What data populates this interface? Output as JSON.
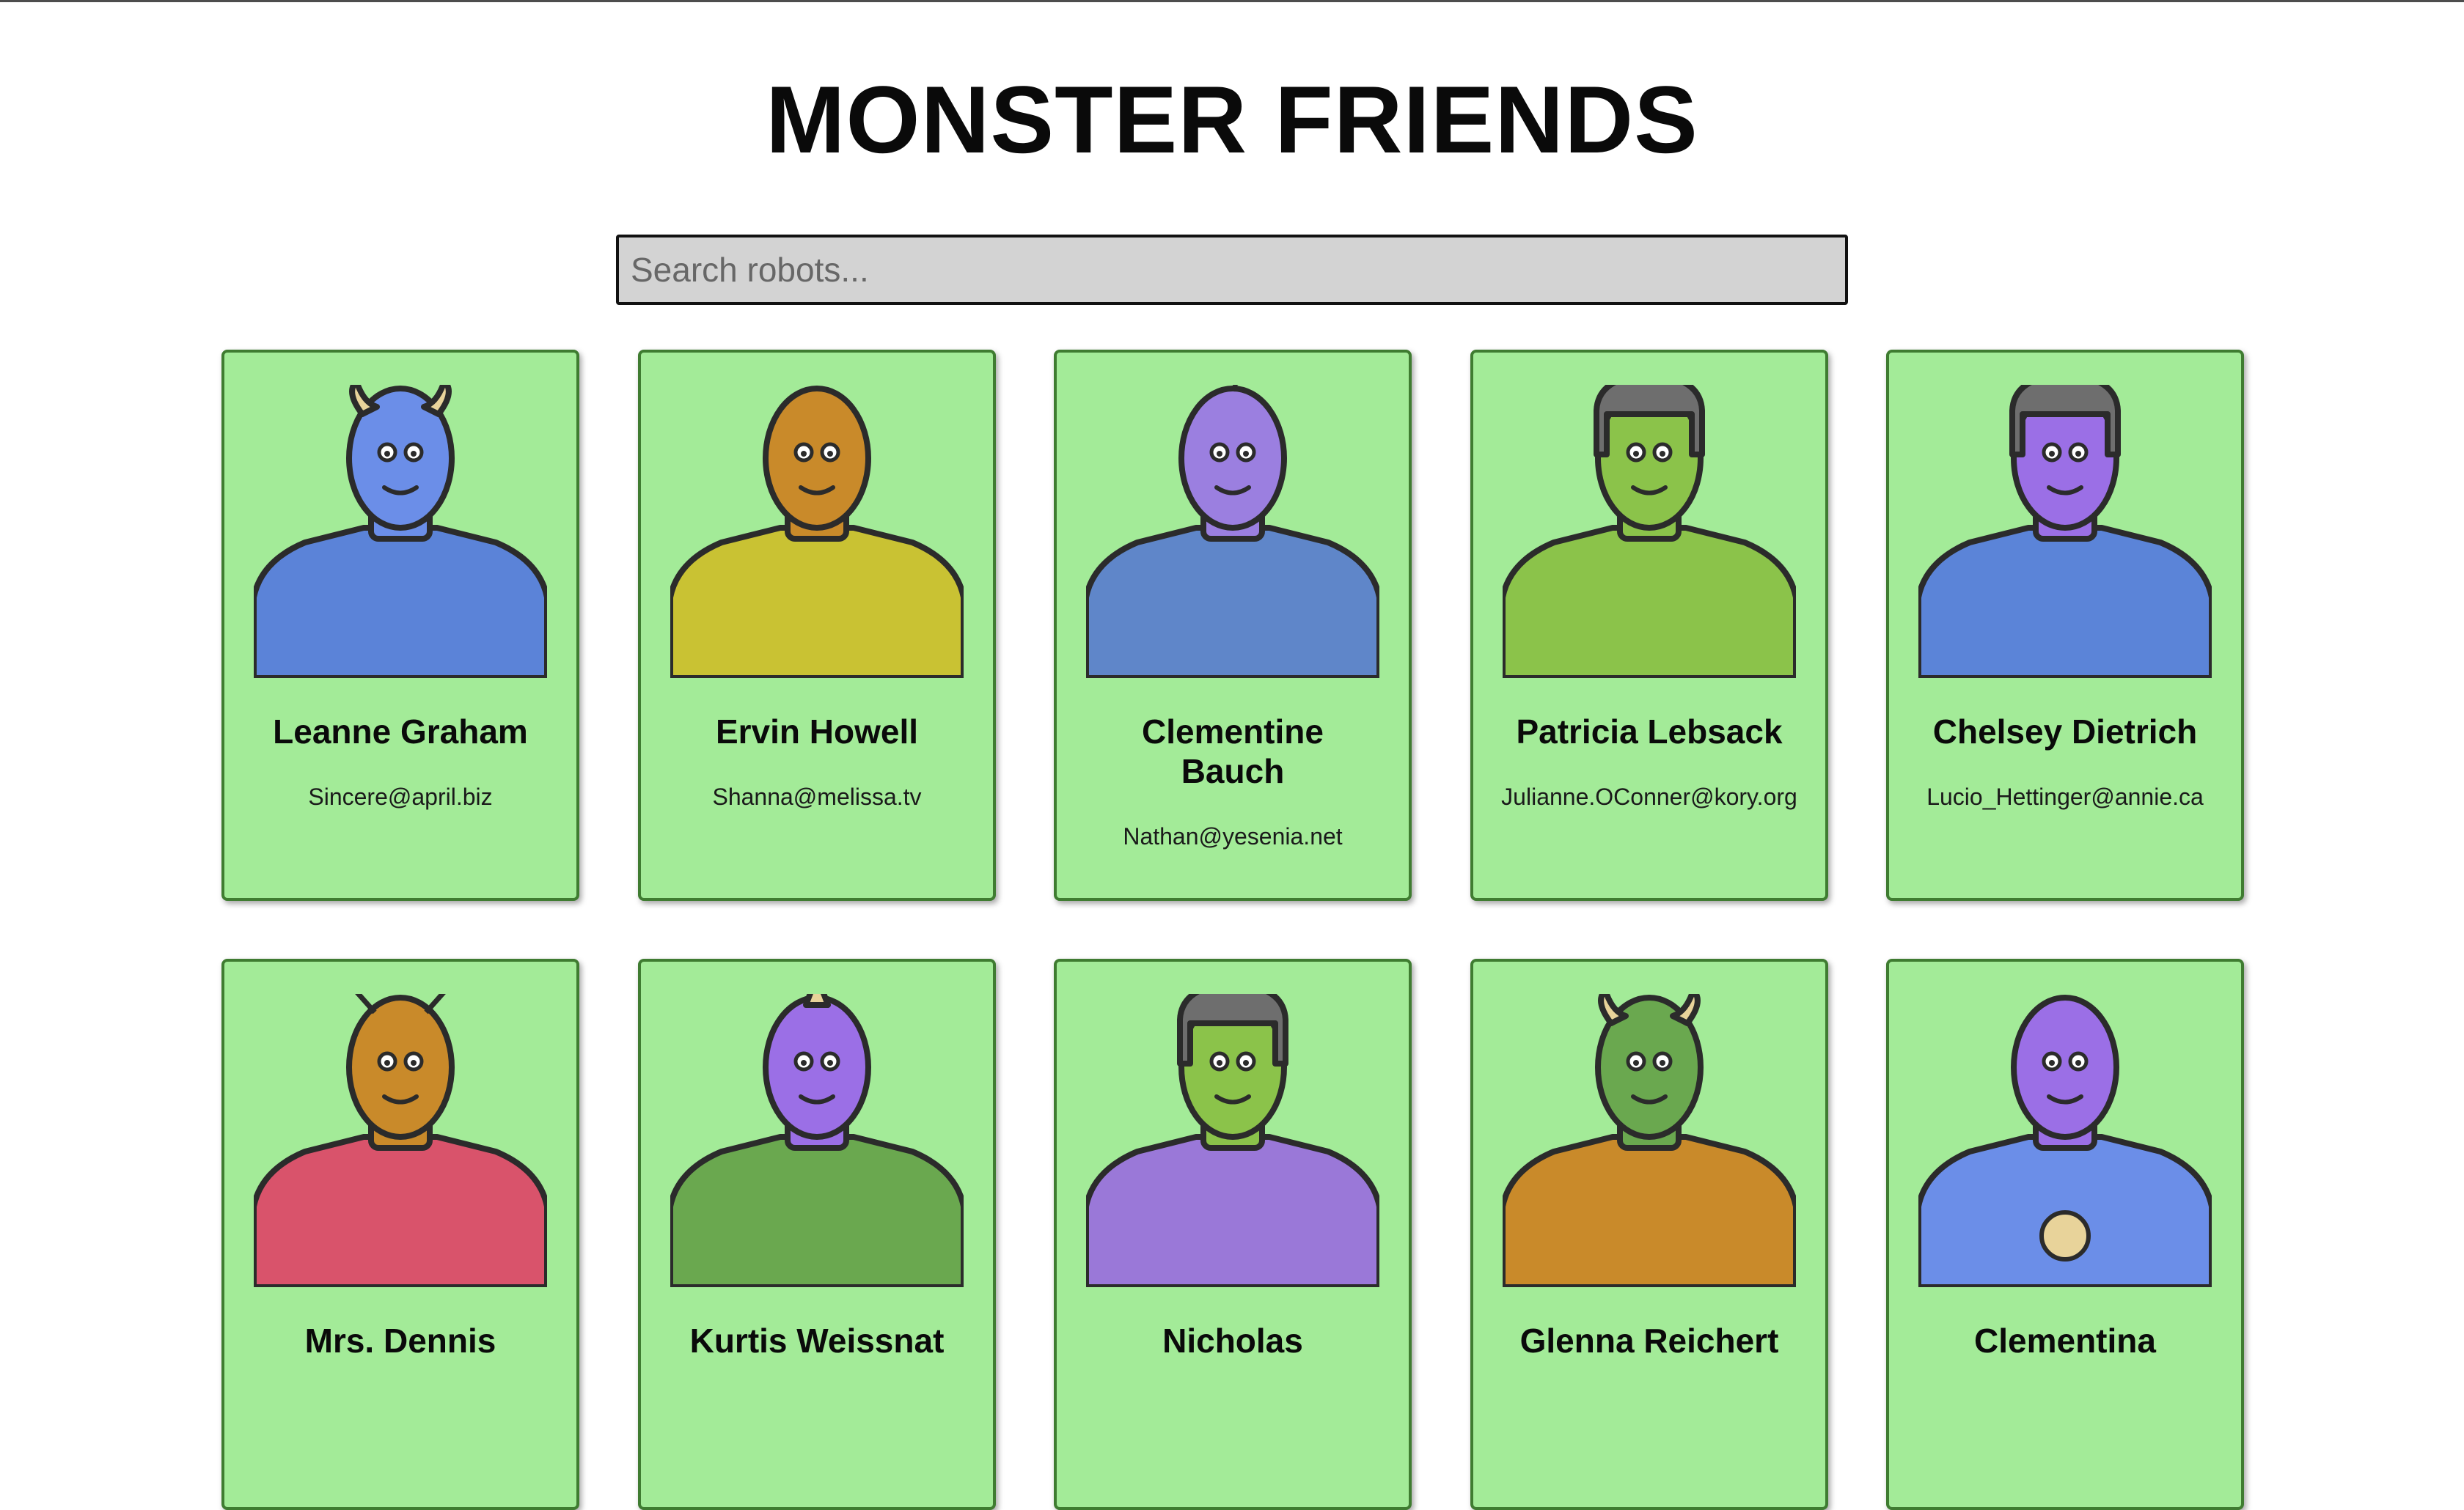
{
  "title": "MONSTER FRIENDS",
  "search": {
    "placeholder": "Search robots..."
  },
  "robots": [
    {
      "name": "Leanne Graham",
      "email": "Sincere@april.biz",
      "skin": "#6b8ee8",
      "suit": "#5b83d8",
      "accessory": "horns"
    },
    {
      "name": "Ervin Howell",
      "email": "Shanna@melissa.tv",
      "skin": "#c98a2a",
      "suit": "#c9c233",
      "accessory": "none"
    },
    {
      "name": "Clementine Bauch",
      "email": "Nathan@yesenia.net",
      "skin": "#9b7fe0",
      "suit": "#5f86c9",
      "accessory": "antenna"
    },
    {
      "name": "Patricia Lebsack",
      "email": "Julianne.OConner@kory.org",
      "skin": "#8bc34a",
      "suit": "#8bc34a",
      "accessory": "helmet"
    },
    {
      "name": "Chelsey Dietrich",
      "email": "Lucio_Hettinger@annie.ca",
      "skin": "#9b6fe6",
      "suit": "#5b84d8",
      "accessory": "helmet"
    },
    {
      "name": "Mrs. Dennis",
      "email": "",
      "skin": "#c98a2a",
      "suit": "#d9536b",
      "accessory": "antennae"
    },
    {
      "name": "Kurtis Weissnat",
      "email": "",
      "skin": "#9b6fe6",
      "suit": "#6aa84f",
      "accessory": "horn"
    },
    {
      "name": "Nicholas",
      "email": "",
      "skin": "#8bc34a",
      "suit": "#9a78d8",
      "accessory": "helmet"
    },
    {
      "name": "Glenna Reichert",
      "email": "",
      "skin": "#6aa84f",
      "suit": "#c98a2a",
      "accessory": "horns"
    },
    {
      "name": "Clementina",
      "email": "",
      "skin": "#9b6fe6",
      "suit": "#6b8ee8",
      "accessory": "smiley"
    }
  ]
}
